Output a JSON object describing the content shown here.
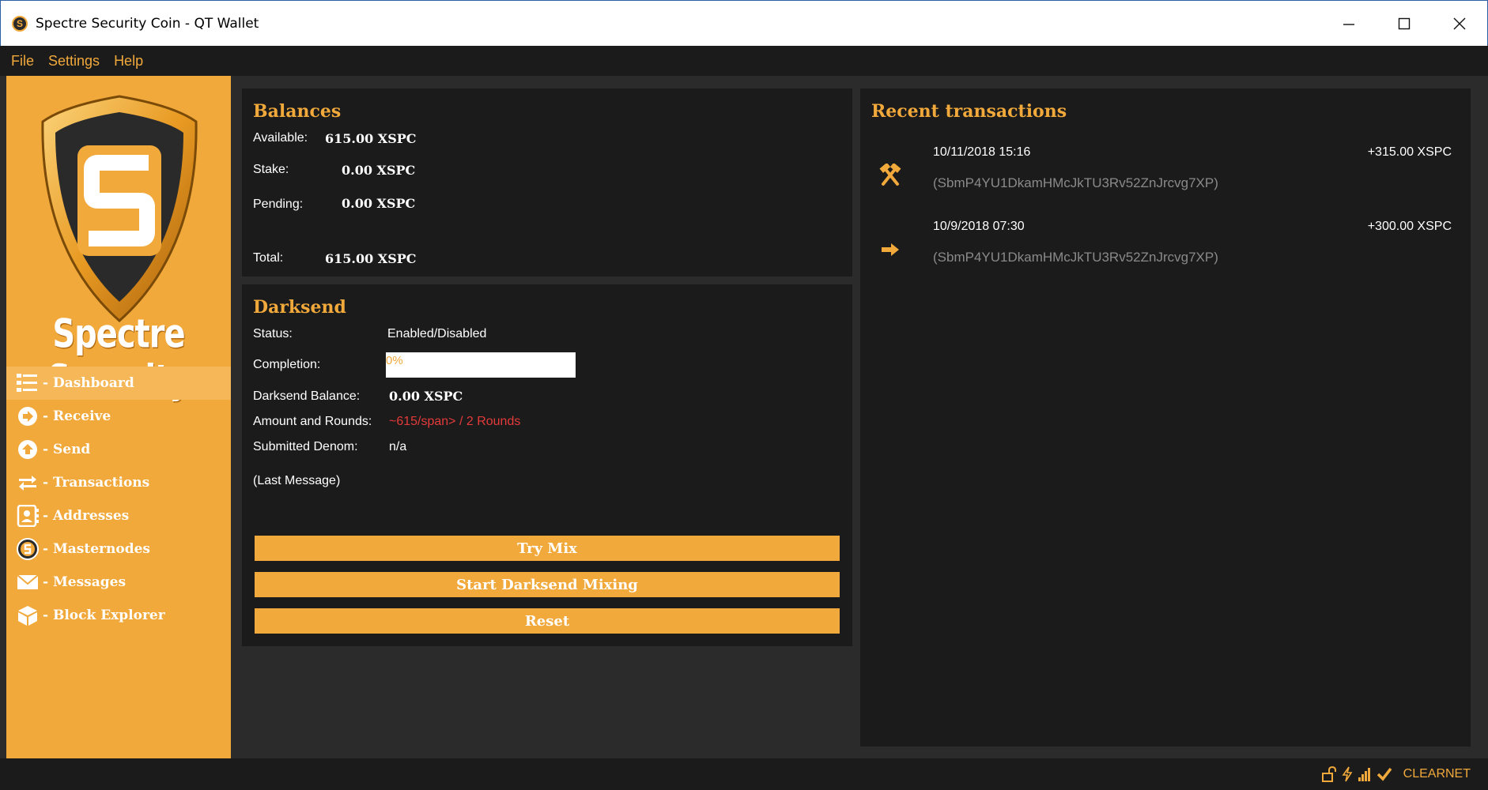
{
  "window": {
    "title": "Spectre Security Coin - QT Wallet",
    "icon": "spectre-logo-icon",
    "controls": [
      "minimize-icon",
      "maximize-icon",
      "close-icon"
    ]
  },
  "menu": [
    {
      "label": "File"
    },
    {
      "label": "Settings"
    },
    {
      "label": "Help"
    }
  ],
  "sidebar": {
    "brand_text": "Spectre Security",
    "items": [
      {
        "label": "- Dashboard",
        "icon": "dashboard-list-icon",
        "active": true
      },
      {
        "label": "- Receive",
        "icon": "receive-arrow-icon"
      },
      {
        "label": "- Send",
        "icon": "send-arrow-icon"
      },
      {
        "label": "- Transactions",
        "icon": "transfer-arrows-icon"
      },
      {
        "label": "- Addresses",
        "icon": "address-book-icon"
      },
      {
        "label": "- Masternodes",
        "icon": "spectre-coin-icon"
      },
      {
        "label": "- Messages",
        "icon": "envelope-icon"
      },
      {
        "label": "- Block Explorer",
        "icon": "cube-icon"
      }
    ]
  },
  "balances": {
    "heading": "Balances",
    "available_label": "Available:",
    "available_value": "615.00 XSPC",
    "stake_label": "Stake:",
    "stake_value": "0.00 XSPC",
    "pending_label": "Pending:",
    "pending_value": "0.00 XSPC",
    "total_label": "Total:",
    "total_value": "615.00 XSPC"
  },
  "darksend": {
    "heading": "Darksend",
    "status_label": "Status:",
    "status_value": "Enabled/Disabled",
    "completion_label": "Completion:",
    "completion_text": "0%",
    "completion_progress": 0.0,
    "balance_label": "Darksend Balance:",
    "balance_value": "0.00 XSPC",
    "rounds_label": "Amount and Rounds:",
    "rounds_value": "~615/span> / 2 Rounds",
    "denom_label": "Submitted Denom:",
    "denom_value": "n/a",
    "last_message": "(Last Message)",
    "buttons": {
      "try_mix": "Try Mix",
      "start_mixing": "Start Darksend Mixing",
      "reset": "Reset"
    }
  },
  "recent": {
    "heading": "Recent transactions",
    "transactions": [
      {
        "date": "10/11/2018 15:16",
        "amount": "+315.00 XSPC",
        "address": "(SbmP4YU1DkamHMcJkTU3Rv52ZnJrcvg7XP)",
        "icon": "mining-hammers-icon"
      },
      {
        "date": "10/9/2018 07:30",
        "amount": "+300.00 XSPC",
        "address": "(SbmP4YU1DkamHMcJkTU3Rv52ZnJrcvg7XP)",
        "icon": "incoming-arrow-icon"
      }
    ]
  },
  "statusbar": {
    "icons": [
      "unlocked-padlock-icon",
      "lightning-icon",
      "signal-bars-icon",
      "checkmark-icon"
    ],
    "network": "CLEARNET"
  },
  "colors": {
    "accent": "#f2a93b",
    "panel": "#1b1b1b",
    "background": "#2b2b2b",
    "alert": "#e53a3a",
    "muted": "#8a8a8a"
  }
}
